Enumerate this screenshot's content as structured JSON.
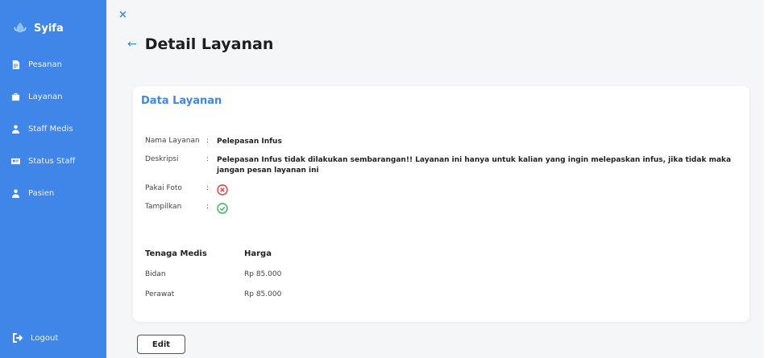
{
  "sidebar": {
    "brand": "Syifa",
    "items": [
      {
        "label": "Pesanan",
        "icon": "document-icon"
      },
      {
        "label": "Layanan",
        "icon": "briefcase-icon"
      },
      {
        "label": "Staff Medis",
        "icon": "user-tie-icon"
      },
      {
        "label": "Status Staff",
        "icon": "id-card-icon"
      },
      {
        "label": "Pasien",
        "icon": "user-icon"
      }
    ],
    "logout": "Logout"
  },
  "header": {
    "close": "×",
    "back": "←",
    "title": "Detail Layanan"
  },
  "card": {
    "title": "Data Layanan",
    "sep": ":",
    "fields": {
      "nama_label": "Nama Layanan",
      "nama_value": "Pelepasan Infus",
      "deskripsi_label": "Deskripsi",
      "deskripsi_value": "Pelepasan Infus tidak dilakukan sembarangan!! Layanan ini hanya untuk kalian yang ingin melepaskan infus, jika tidak maka jangan pesan layanan ini",
      "pakai_foto_label": "Pakai Foto",
      "pakai_foto_value": false,
      "tampilkan_label": "Tampilkan",
      "tampilkan_value": true
    },
    "table": {
      "headers": [
        "Tenaga Medis",
        "Harga"
      ],
      "rows": [
        [
          "Bidan",
          "Rp 85.000"
        ],
        [
          "Perawat",
          "Rp 85.000"
        ]
      ]
    }
  },
  "actions": {
    "edit": "Edit"
  },
  "colors": {
    "primary": "#3f86e8",
    "danger": "#e53935",
    "success": "#2eb85c"
  }
}
